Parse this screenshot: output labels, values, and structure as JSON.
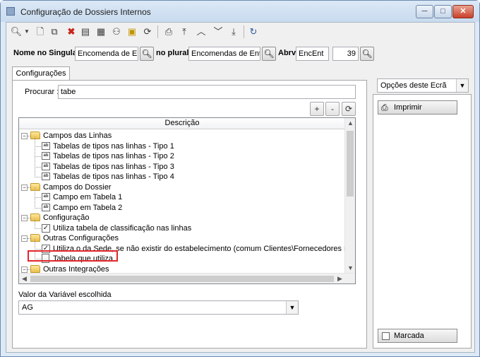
{
  "window": {
    "title": "Configuração de Dossiers Internos",
    "controls": {
      "minimize": "─",
      "maximize": "□",
      "close": "✕"
    }
  },
  "toolbar": {
    "icons": [
      "search-icon",
      "dropdown-arrow-icon",
      "new-document-icon",
      "copy-icon",
      "delete-icon",
      "properties-icon",
      "grid-icon",
      "hierarchy-icon",
      "find-folder-icon",
      "refresh-icon",
      "preview-icon",
      "first-icon",
      "previous-icon",
      "next-icon",
      "last-icon",
      "reload-icon"
    ]
  },
  "names": {
    "singular_label": "Nome no Singular",
    "singular_value": "Encomenda de Entidade",
    "plural_label": "no plural",
    "plural_value": "Encomendas de Entidade",
    "abbr_label": "Abrv.",
    "abbr_value": "EncEnt",
    "number_value": "39"
  },
  "tab": {
    "label": "Configurações"
  },
  "search": {
    "label": "Procurar :",
    "value": "tabe"
  },
  "tree": {
    "header": "Descrição",
    "items": [
      {
        "type": "folder",
        "level": 0,
        "label": "Campos das Linhas"
      },
      {
        "type": "field",
        "level": 1,
        "label": "Tabelas de tipos nas linhas - Tipo 1"
      },
      {
        "type": "field",
        "level": 1,
        "label": "Tabelas de tipos nas linhas - Tipo 2"
      },
      {
        "type": "field",
        "level": 1,
        "label": "Tabelas de tipos nas linhas - Tipo 3"
      },
      {
        "type": "field",
        "level": 1,
        "label": "Tabelas de tipos nas linhas - Tipo 4"
      },
      {
        "type": "folder",
        "level": 0,
        "label": "Campos do Dossier"
      },
      {
        "type": "field",
        "level": 1,
        "label": "Campo em Tabela 1"
      },
      {
        "type": "field",
        "level": 1,
        "label": "Campo em Tabela 2"
      },
      {
        "type": "folder",
        "level": 0,
        "label": "Configuração"
      },
      {
        "type": "check",
        "level": 1,
        "label": "Utiliza tabela de classificação nas linhas"
      },
      {
        "type": "folder",
        "level": 0,
        "label": "Outras Configurações"
      },
      {
        "type": "check",
        "level": 1,
        "label": "Utiliza o da Sede, se não existir do estabelecimento (comum Clientes\\Fornecedores media"
      },
      {
        "type": "doc",
        "level": 1,
        "label": "Tabela que utiliza"
      },
      {
        "type": "folder",
        "level": 0,
        "label": "Outras Integrações"
      }
    ]
  },
  "value_field": {
    "label": "Valor da Variável escolhida",
    "value": "AG"
  },
  "side": {
    "combo": "Opções deste Ecrã",
    "print_label": "Imprimir",
    "marked_label": "Marcada"
  }
}
